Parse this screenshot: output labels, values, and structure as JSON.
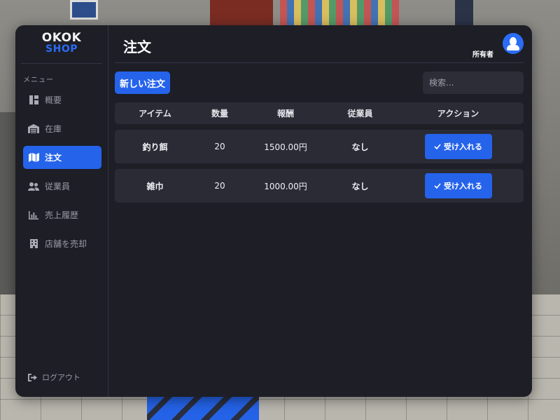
{
  "brand": {
    "line1": "OKOK",
    "line2": "SHOP",
    "accent": "#2563eb"
  },
  "sidebar": {
    "menu_label": "メニュー",
    "items": [
      {
        "label": "概要",
        "icon": "dashboard-icon",
        "active": false
      },
      {
        "label": "在庫",
        "icon": "warehouse-icon",
        "active": false
      },
      {
        "label": "注文",
        "icon": "map-icon",
        "active": true
      },
      {
        "label": "従業員",
        "icon": "users-icon",
        "active": false
      },
      {
        "label": "売上履歴",
        "icon": "chart-icon",
        "active": false
      },
      {
        "label": "店舗を売却",
        "icon": "building-icon",
        "active": false
      }
    ],
    "logout_label": "ログアウト"
  },
  "header": {
    "title": "注文",
    "owner_label": "所有者"
  },
  "toolbar": {
    "new_order_label": "新しい注文",
    "search_placeholder": "検索..."
  },
  "table": {
    "headers": [
      "アイテム",
      "数量",
      "報酬",
      "従業員",
      "アクション"
    ],
    "rows": [
      {
        "item": "釣り餌",
        "qty": "20",
        "reward": "1500.00円",
        "employee": "なし",
        "action": "受け入れる"
      },
      {
        "item": "雑巾",
        "qty": "20",
        "reward": "1000.00円",
        "employee": "なし",
        "action": "受け入れる"
      }
    ]
  }
}
